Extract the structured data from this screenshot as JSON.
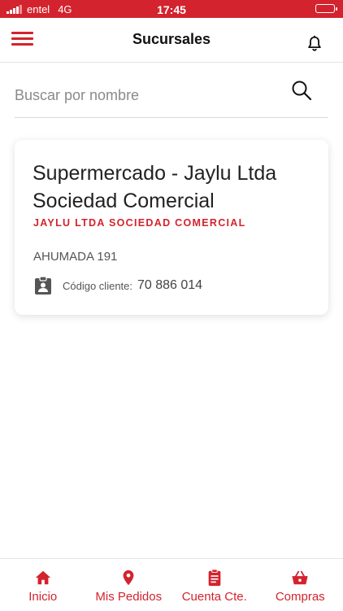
{
  "status_bar": {
    "carrier": "entel",
    "network": "4G",
    "time": "17:45"
  },
  "header": {
    "title": "Sucursales"
  },
  "search": {
    "placeholder": "Buscar por nombre",
    "value": ""
  },
  "branches": [
    {
      "name": "Supermercado - Jaylu Ltda Sociedad Comercial",
      "company": "JAYLU LTDA SOCIEDAD COMERCIAL",
      "address": "AHUMADA 191",
      "client_code_label": "Código cliente:",
      "client_code": "70 886 014"
    }
  ],
  "tabs": [
    {
      "label": "Inicio",
      "icon": "home-icon"
    },
    {
      "label": "Mis Pedidos",
      "icon": "location-pin-icon"
    },
    {
      "label": "Cuenta Cte.",
      "icon": "clipboard-icon"
    },
    {
      "label": "Compras",
      "icon": "basket-icon"
    }
  ],
  "colors": {
    "brand": "#d3232e",
    "text": "#222222"
  }
}
